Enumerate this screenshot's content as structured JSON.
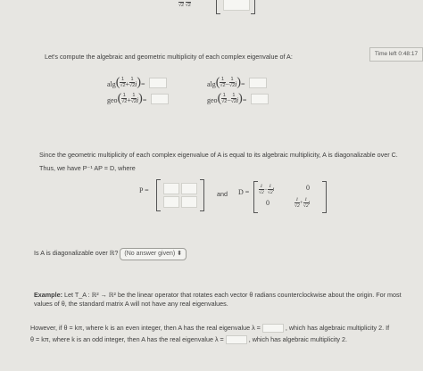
{
  "timer": {
    "label": "Time left 0:48:17"
  },
  "intro": {
    "text": "Let's compute the algebraic and geometric multiplicity of each complex eigenvalue of A:"
  },
  "multiplicity": {
    "alg": "alg",
    "geo": "geo",
    "equals": "=",
    "one": "1",
    "sqrt2": "√2",
    "plus": "+",
    "minus": "−",
    "i": "i"
  },
  "statement": {
    "text": "Since the geometric multiplicity of each complex eigenvalue of A is equal to its algebraic multiplicity, A is diagonalizable over C."
  },
  "thus": {
    "text": "Thus, we have P⁻¹ AP = D, where"
  },
  "matrices": {
    "p_label": "P =",
    "and": "and",
    "d_label": "D =",
    "zero": "0"
  },
  "question": {
    "text": "Is A is diagonalizable over ℝ?",
    "select_value": "(No answer given)",
    "select_arrow": "⬍"
  },
  "example": {
    "lead": "Example:",
    "text": "Let T_A : ℝ² → ℝ² be the linear operator that rotates each vector θ radians counterclockwise about the origin. For most values of θ, the standard matrix A will not have any real eigenvalues."
  },
  "however": {
    "line1_a": "However, if θ = kπ, where k is an even integer, then A has the real eigenvalue λ =",
    "line1_b": ", which has algebraic multiplicity 2. If",
    "line2_a": "θ = kπ, where k is an odd integer, then A has the real eigenvalue λ =",
    "line2_b": ", which has algebraic multiplicity 2."
  }
}
